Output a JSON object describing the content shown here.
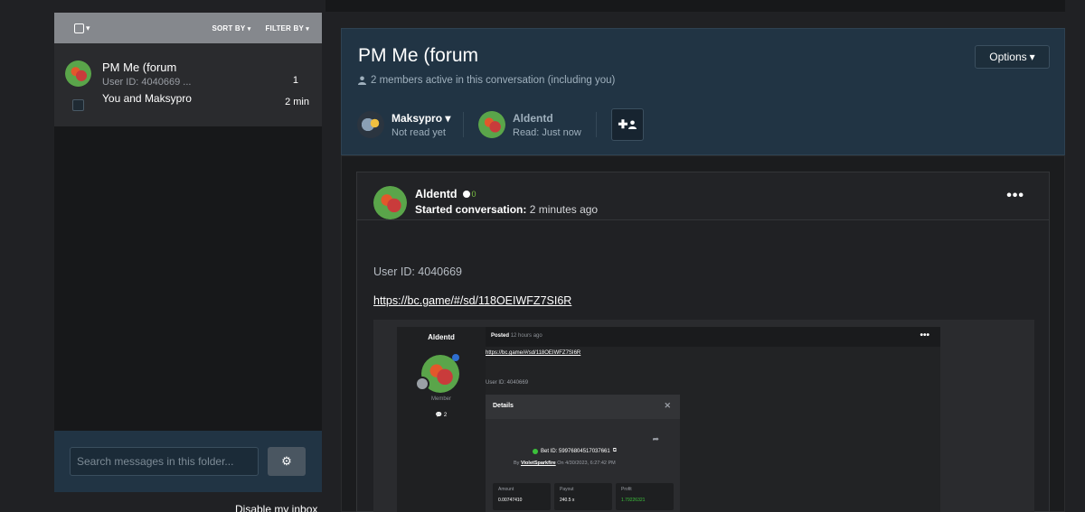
{
  "toolbar": {
    "sort_label": "SORT BY",
    "filter_label": "FILTER BY"
  },
  "conversation_list": {
    "items": [
      {
        "title": "PM Me (forum",
        "preview": "User ID: 4040669 ...",
        "count": "1",
        "members": "You and Maksypro",
        "time": "2 min"
      }
    ]
  },
  "search": {
    "placeholder": "Search messages in this folder..."
  },
  "footer": {
    "disable_inbox": "Disable my inbox"
  },
  "conversation": {
    "title": "PM Me (forum",
    "members_active": "2 members active in this conversation (including you)",
    "options_label": "Options",
    "participants": [
      {
        "name": "Maksypro",
        "status": "Not read yet"
      },
      {
        "name": "Aldentd",
        "status": "Read: Just now"
      }
    ]
  },
  "message": {
    "author": "Aldentd",
    "online_count": "0",
    "started_label": "Started conversation:",
    "started_time": "2 minutes ago",
    "user_id_line": "User ID: 4040669",
    "link_text": "https://bc.game/#/sd/118OEIWFZ7SI6R"
  },
  "embedded_screenshot": {
    "author": "Aldentd",
    "role": "Member",
    "posts": "2",
    "posted_label": "Posted",
    "posted_time": "12 hours ago",
    "link_text": "https://bc.game/#/sd/118OEIWFZ7SI6R",
    "user_id_line": "User ID: 4040669",
    "details_title": "Details",
    "bet_id": "Bet ID: 59976804517037661",
    "by_label": "By",
    "by_user": "VioletSparkfire",
    "on_label": "On",
    "on_date": "4/30/2023, 6:27:42 PM",
    "stats": [
      {
        "label": "Amount",
        "value": "0.00747410"
      },
      {
        "label": "Payout",
        "value": "240.5 x"
      },
      {
        "label": "Profit",
        "value": "1.79226321"
      }
    ]
  },
  "colors": {
    "header_bg": "#213444",
    "toolbar_bg": "#85888d",
    "online_green": "#7bc043"
  }
}
